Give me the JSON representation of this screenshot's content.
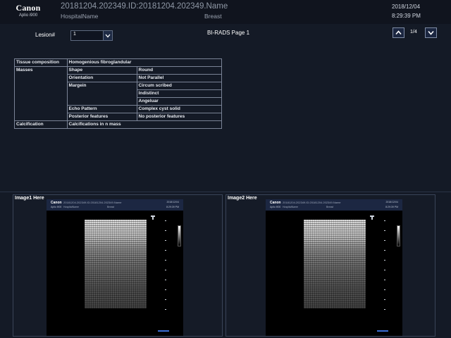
{
  "header": {
    "brand": "Canon",
    "model": "Aplio i900",
    "patient_id": "20181204.202349.ID:20181204.202349.Name",
    "hospital": "HospitalName",
    "exam": "Breast",
    "date": "2018/12/04",
    "time": "8:29:39 PM"
  },
  "toolbar": {
    "lesion_label": "Lesion#",
    "lesion_value": "1",
    "page_title": "BI-RADS Page 1",
    "page_count": "1/4"
  },
  "birads": {
    "rows": [
      [
        "Tissue composition",
        "Homogenious fibroglandular",
        null
      ],
      [
        "Masses",
        "Shape",
        "Round"
      ],
      [
        null,
        "Orientation",
        "Not Parallel"
      ],
      [
        null,
        "Margein",
        "Circum scribed"
      ],
      [
        null,
        null,
        "Indistinct"
      ],
      [
        null,
        null,
        "Angeluar"
      ],
      [
        null,
        "Echo Pattern",
        "Complex cyst solid"
      ],
      [
        null,
        "Posterior features",
        "No posterior features"
      ],
      [
        "Calcification",
        "Calcifications in n mass",
        null
      ]
    ]
  },
  "images": [
    {
      "label": "Image1 Here",
      "thumb": {
        "brand": "Canon",
        "sub": "Aplio i900",
        "line1": "20181204.202349.ID:20181204.202349.Name",
        "line2": "HospitalName",
        "exam": "Breast",
        "date": "2018/12/04",
        "time": "8:29:39 PM"
      }
    },
    {
      "label": "Image2 Here",
      "thumb": {
        "brand": "Canon",
        "sub": "Aplio i900",
        "line1": "20181204.202349.ID:20181204.202349.Name",
        "line2": "HospitalName",
        "exam": "Breast",
        "date": "2018/12/04",
        "time": "8:29:39 PM"
      }
    }
  ],
  "icons": {
    "lesion_dropdown": "chevron-down-icon",
    "page_up": "chevron-up-icon",
    "page_down": "chevron-down-icon"
  },
  "colors": {
    "background": "#141a26",
    "header": "#10141e",
    "button": "#1b2640",
    "scale_bar": "#3d6fd6"
  }
}
